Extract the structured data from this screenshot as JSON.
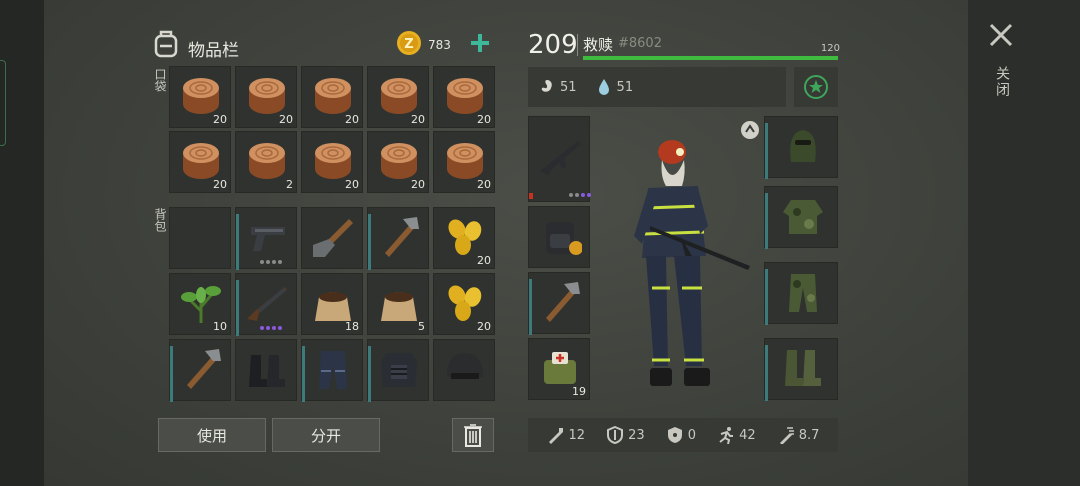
{
  "inventory": {
    "title": "物品栏",
    "coins": "783",
    "pocket_label": "口袋",
    "backpack_label": "背包",
    "pocket_slots": [
      {
        "icon": "wood-log-icon",
        "qty": "20"
      },
      {
        "icon": "wood-log-icon",
        "qty": "20"
      },
      {
        "icon": "wood-log-icon",
        "qty": "20"
      },
      {
        "icon": "wood-log-icon",
        "qty": "20"
      },
      {
        "icon": "wood-log-icon",
        "qty": "20"
      },
      {
        "icon": "wood-log-icon",
        "qty": "20"
      },
      {
        "icon": "wood-log-icon",
        "qty": "2"
      },
      {
        "icon": "wood-log-icon",
        "qty": "20"
      },
      {
        "icon": "wood-log-icon",
        "qty": "20"
      },
      {
        "icon": "wood-log-icon",
        "qty": "20"
      }
    ],
    "backpack_slots": [
      {
        "icon": "",
        "qty": ""
      },
      {
        "icon": "pistol-icon",
        "qty": ""
      },
      {
        "icon": "shovel-icon",
        "qty": ""
      },
      {
        "icon": "hatchet-icon",
        "qty": ""
      },
      {
        "icon": "corn-seeds-icon",
        "qty": "20"
      },
      {
        "icon": "herb-plant-icon",
        "qty": "10"
      },
      {
        "icon": "shotgun-icon",
        "qty": ""
      },
      {
        "icon": "soil-sack-icon",
        "qty": "18"
      },
      {
        "icon": "soil-sack-icon",
        "qty": "5"
      },
      {
        "icon": "corn-seeds-icon",
        "qty": "20"
      },
      {
        "icon": "hatchet-icon",
        "qty": ""
      },
      {
        "icon": "boots-icon",
        "qty": ""
      },
      {
        "icon": "pants-icon",
        "qty": ""
      },
      {
        "icon": "armor-vest-icon",
        "qty": ""
      },
      {
        "icon": "helmet-icon",
        "qty": ""
      }
    ],
    "use_button": "使用",
    "split_button": "分开"
  },
  "character": {
    "level": "209",
    "name": "救赎",
    "id": "#8602",
    "health_max": "120",
    "health_fraction": 1.0,
    "hunger": "51",
    "thirst": "51",
    "weapon_slots": [
      {
        "icon": "assault-rifle-icon",
        "qty": ""
      },
      {
        "icon": "backpack-icon",
        "qty": ""
      },
      {
        "icon": "hatchet-icon",
        "qty": ""
      },
      {
        "icon": "medkit-bag-icon",
        "qty": "19"
      }
    ],
    "armor_slots": [
      {
        "icon": "balaclava-icon"
      },
      {
        "icon": "camo-jacket-icon"
      },
      {
        "icon": "camo-pants-icon"
      },
      {
        "icon": "camo-boots-icon"
      }
    ],
    "stats": [
      {
        "icon": "sword-icon",
        "value": "12"
      },
      {
        "icon": "shield-icon",
        "value": "23"
      },
      {
        "icon": "radiation-shield-icon",
        "value": "0"
      },
      {
        "icon": "running-icon",
        "value": "42"
      },
      {
        "icon": "melee-speed-icon",
        "value": "8.7"
      }
    ]
  },
  "close_label": "关闭",
  "colors": {
    "health_bar": "#3fbb3f",
    "accent_green": "#3ea65a",
    "coin": "#e8b020",
    "quality_purple": "#8a5ae0",
    "slot_bar": "#3c7a7c"
  }
}
